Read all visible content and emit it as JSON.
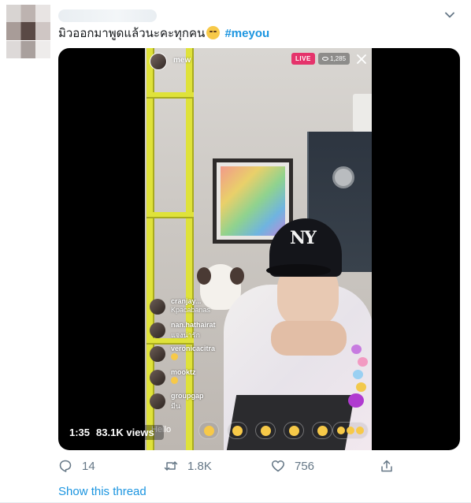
{
  "tweet": {
    "text": "มิวออกมาพูดแล้วนะคะทุกคน",
    "hashtag": "#meyou",
    "show_thread_label": "Show this thread"
  },
  "video": {
    "duration": "1:35",
    "views": "83.1K views",
    "stream": {
      "username": "mew",
      "live_label": "LIVE",
      "viewer_count": "1,285",
      "composer_placeholder": "Hello",
      "comments": [
        {
          "user": "cranjay...",
          "text": "Kpacabanas"
        },
        {
          "user": "nan.hathairat",
          "text": "แจงน่ารัก"
        },
        {
          "user": "veronicacitra",
          "text": ""
        },
        {
          "user": "mooktz",
          "text": ""
        },
        {
          "user": "groupgap",
          "text": "มีน"
        }
      ]
    }
  },
  "actions": {
    "replies": "14",
    "retweets": "1.8K",
    "likes": "756"
  },
  "colors": {
    "link": "#1b95e0",
    "icon_gray": "#657786",
    "live_red": "#e5336b",
    "ladder_yellow": "#dfe23a"
  },
  "icons": {
    "menu": "chevron-down-icon",
    "reply": "reply-icon",
    "retweet": "retweet-icon",
    "like": "heart-icon",
    "share": "share-icon"
  }
}
